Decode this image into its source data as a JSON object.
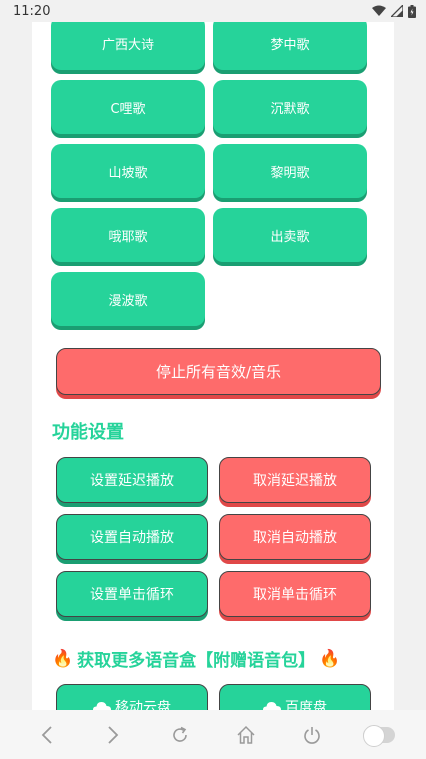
{
  "status": {
    "time": "11:20"
  },
  "songs": [
    {
      "label": "广西大诗"
    },
    {
      "label": "梦中歌"
    },
    {
      "label": "C哩歌"
    },
    {
      "label": "沉默歌"
    },
    {
      "label": "山坡歌"
    },
    {
      "label": "黎明歌"
    },
    {
      "label": "哦耶歌"
    },
    {
      "label": "出卖歌"
    },
    {
      "label": "漫波歌"
    }
  ],
  "stop_all_label": "停止所有音效/音乐",
  "section_title": "功能设置",
  "options": {
    "set_delay": "设置延迟播放",
    "cancel_delay": "取消延迟播放",
    "set_auto": "设置自动播放",
    "cancel_auto": "取消自动播放",
    "set_loop": "设置单击循环",
    "cancel_loop": "取消单击循环"
  },
  "promo": {
    "text": "获取更多语音盒【附赠语音包】"
  },
  "cloud": {
    "mobile": "移动云盘",
    "baidu": "百度盘"
  },
  "colors": {
    "green": "#26d39a",
    "red": "#fe6b6b"
  }
}
